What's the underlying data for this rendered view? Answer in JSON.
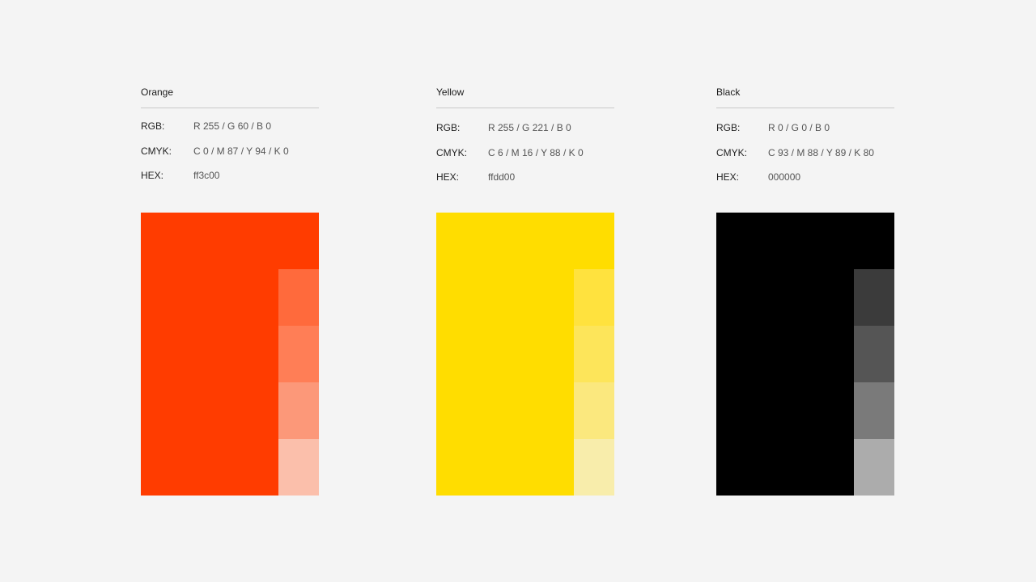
{
  "colors": [
    {
      "name": "Orange",
      "rgb_label": "RGB:",
      "rgb": "R 255 / G 60 / B 0",
      "cmyk_label": "CMYK:",
      "cmyk": "C 0 / M 87 / Y 94 / K 0",
      "hex_label": "HEX:",
      "hex": "ff3c00",
      "swatch_color": "#ff3c00",
      "tints": [
        "#ff6a3c",
        "#ff7e56",
        "#fc9879",
        "#fbbfab"
      ]
    },
    {
      "name": "Yellow",
      "rgb_label": "RGB:",
      "rgb": "R 255 / G 221 / B 0",
      "cmyk_label": "CMYK:",
      "cmyk": "C 6 / M 16 / Y 88 / K 0",
      "hex_label": "HEX:",
      "hex": "ffdd00",
      "swatch_color": "#ffdd00",
      "tints": [
        "#ffe23e",
        "#fde55a",
        "#fbe87e",
        "#f8edab"
      ]
    },
    {
      "name": "Black",
      "rgb_label": "RGB:",
      "rgb": "R 0 / G 0 / B 0",
      "cmyk_label": "CMYK:",
      "cmyk": "C 93 / M 88 / Y 89 / K 80",
      "hex_label": "HEX:",
      "hex": "000000",
      "swatch_color": "#000000",
      "tints": [
        "#3b3b3b",
        "#555555",
        "#7a7a7a",
        "#acacac"
      ]
    }
  ]
}
